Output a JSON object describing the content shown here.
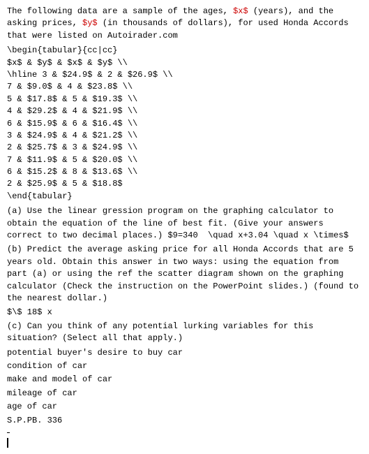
{
  "intro": {
    "line1": "The following data are a sample of the ages, $x$ (years), and the",
    "line2": "asking prices, $y$ (in thousands of dollars), for used Honda Accords",
    "line3": "that were listed on Autoirader.com"
  },
  "table": {
    "begin": "\\begin{tabular}{cc|cc}",
    "header": "$x$ & $y$ & $x$ & $y$ \\\\",
    "hline": "\\hline 3 & $24.9$ & 2 & $26.9$ \\\\",
    "rows": [
      "7 & $9.0$ & 4 & $23.8$ \\\\",
      "5 & $17.8$ & 5 & $19.3$ \\\\",
      "4 & $29.2$ & 4 & $21.9$ \\\\",
      "6 & $15.9$ & 6 & $16.4$ \\\\",
      "3 & $24.9$ & 4 & $21.2$ \\\\",
      "2 & $25.7$ & 3 & $24.9$ \\\\",
      "7 & $11.9$ & 5 & $20.0$ \\\\",
      "6 & $15.2$ & 8 & $13.6$ \\\\",
      "2 & $25.9$ & 5 & $18.8$"
    ],
    "end": "\\end{tabular}"
  },
  "questions": {
    "a": {
      "text": "(a) Use the linear gression program on the graphing calculator to obtain the equation of the line of best fit. (Give your answers correct to two decimal places.) $9=340 \\quad x+3.04 \\quad x \\times$",
      "suffix": "(b) Predict the average asking price for all Honda Accords that are 5 years old. Obtain this answer in two ways: using the equation from part (a) or using the ref the scatter diagram shown on the graphing calculator (Check the instruction on the PowerPoint slides.) (found to the nearest dollar.)"
    },
    "b_answer": "$\\$ 18$ x",
    "c": {
      "text": "(c) Can you think of any potential lurking variables for this situation? (Select all that apply.)",
      "options": [
        "potential buyer's desire to buy car",
        "condition of car",
        "make and model of car",
        "mileage of car",
        "age of car"
      ]
    },
    "footer": "S.P.PB.  336"
  }
}
